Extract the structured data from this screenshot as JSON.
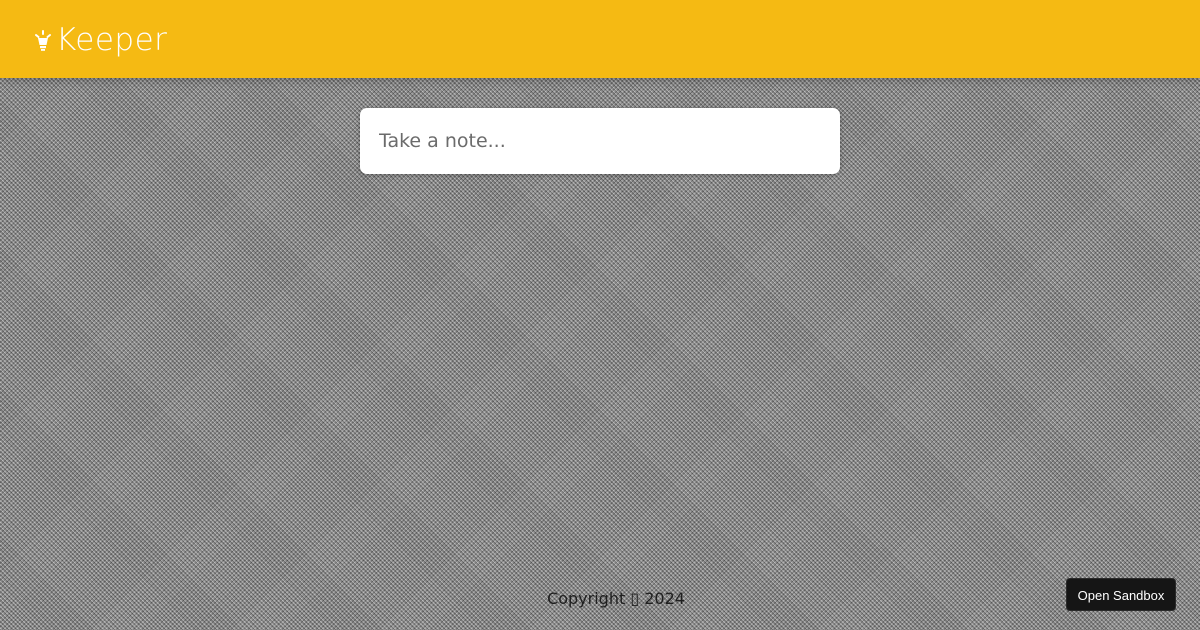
{
  "header": {
    "title": "Keeper",
    "icon": "lightbulb-icon",
    "background_color": "#f5ba13",
    "text_color": "#ffffff"
  },
  "note_form": {
    "placeholder": "Take a note...",
    "value": ""
  },
  "footer": {
    "copyright": "Copyright ▯ 2024"
  },
  "sandbox_button": {
    "label": "Open Sandbox"
  }
}
